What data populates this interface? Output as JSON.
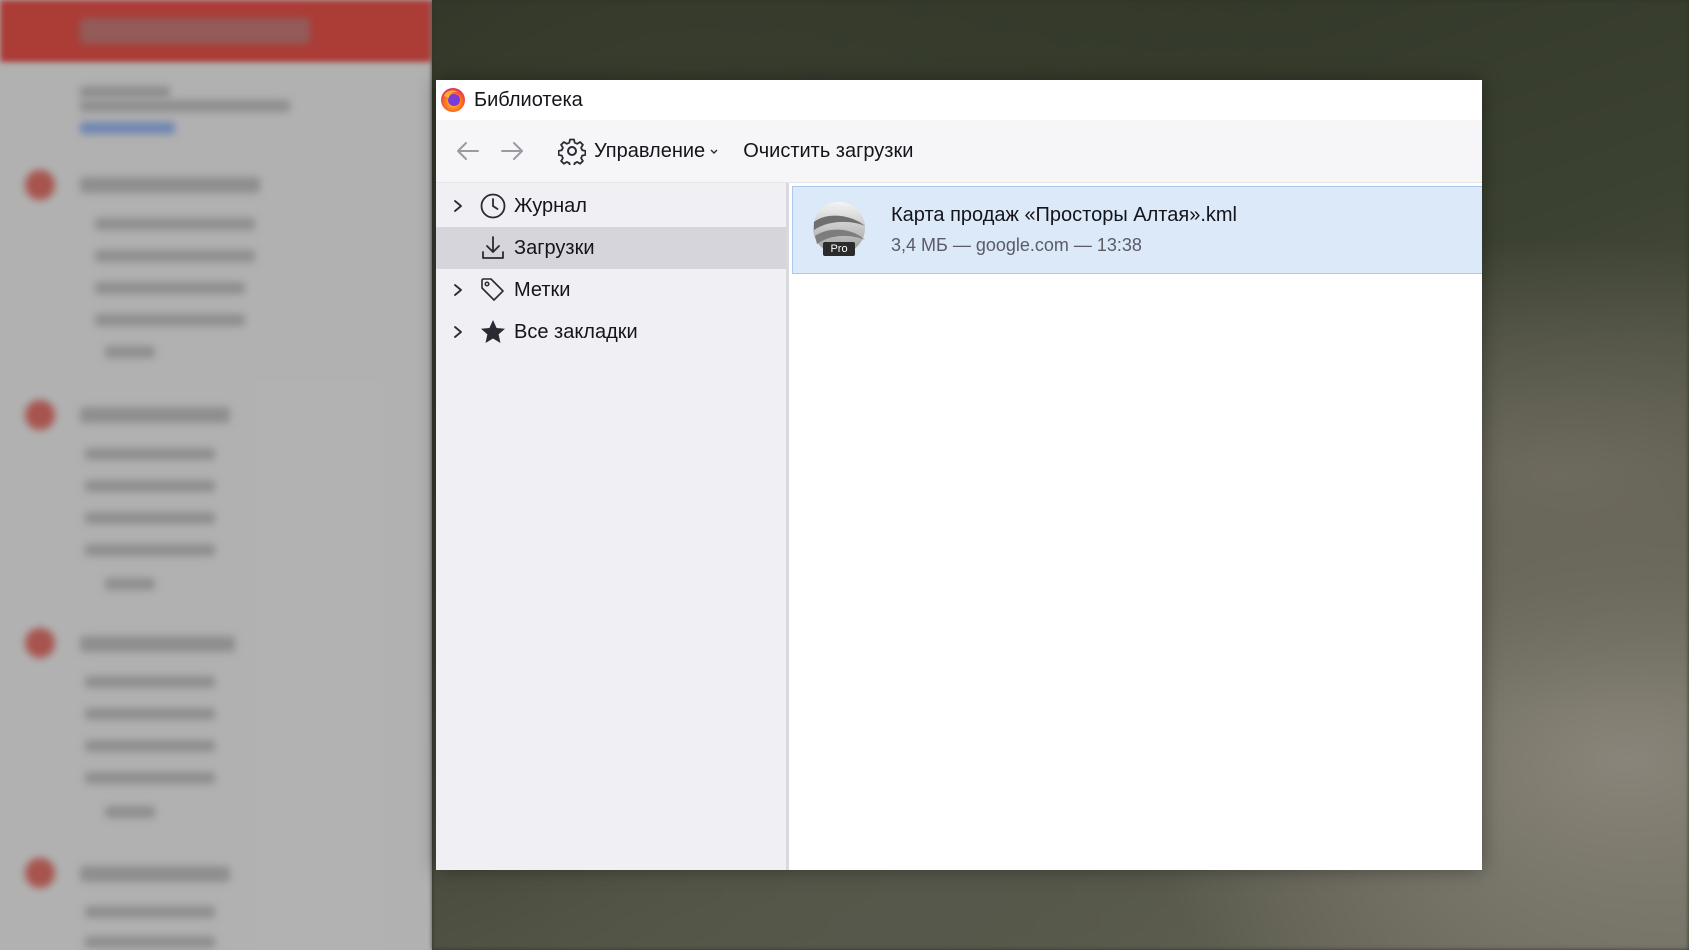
{
  "window": {
    "title": "Библиотека"
  },
  "toolbar": {
    "manage_label": "Управление",
    "clear_label": "Очистить загрузки"
  },
  "sidebar": {
    "items": [
      {
        "label": "Журнал",
        "icon": "clock-icon",
        "expandable": true,
        "selected": false
      },
      {
        "label": "Загрузки",
        "icon": "download-icon",
        "expandable": false,
        "selected": true
      },
      {
        "label": "Метки",
        "icon": "tag-icon",
        "expandable": true,
        "selected": false
      },
      {
        "label": "Все закладки",
        "icon": "star-icon",
        "expandable": true,
        "selected": false
      }
    ]
  },
  "downloads": [
    {
      "name": "Карта продаж «Просторы Алтая».kml",
      "meta": "3,4 МБ — google.com — 13:38",
      "badge": "Pro",
      "icon": "google-earth-pro-icon"
    }
  ],
  "colors": {
    "selected_row": "#dce9f9",
    "selected_row_border": "#a9c8ee",
    "sidebar_bg": "#f0eff4",
    "sidebar_selected": "#d6d5dc",
    "toolbar_bg": "#f6f6f9"
  }
}
